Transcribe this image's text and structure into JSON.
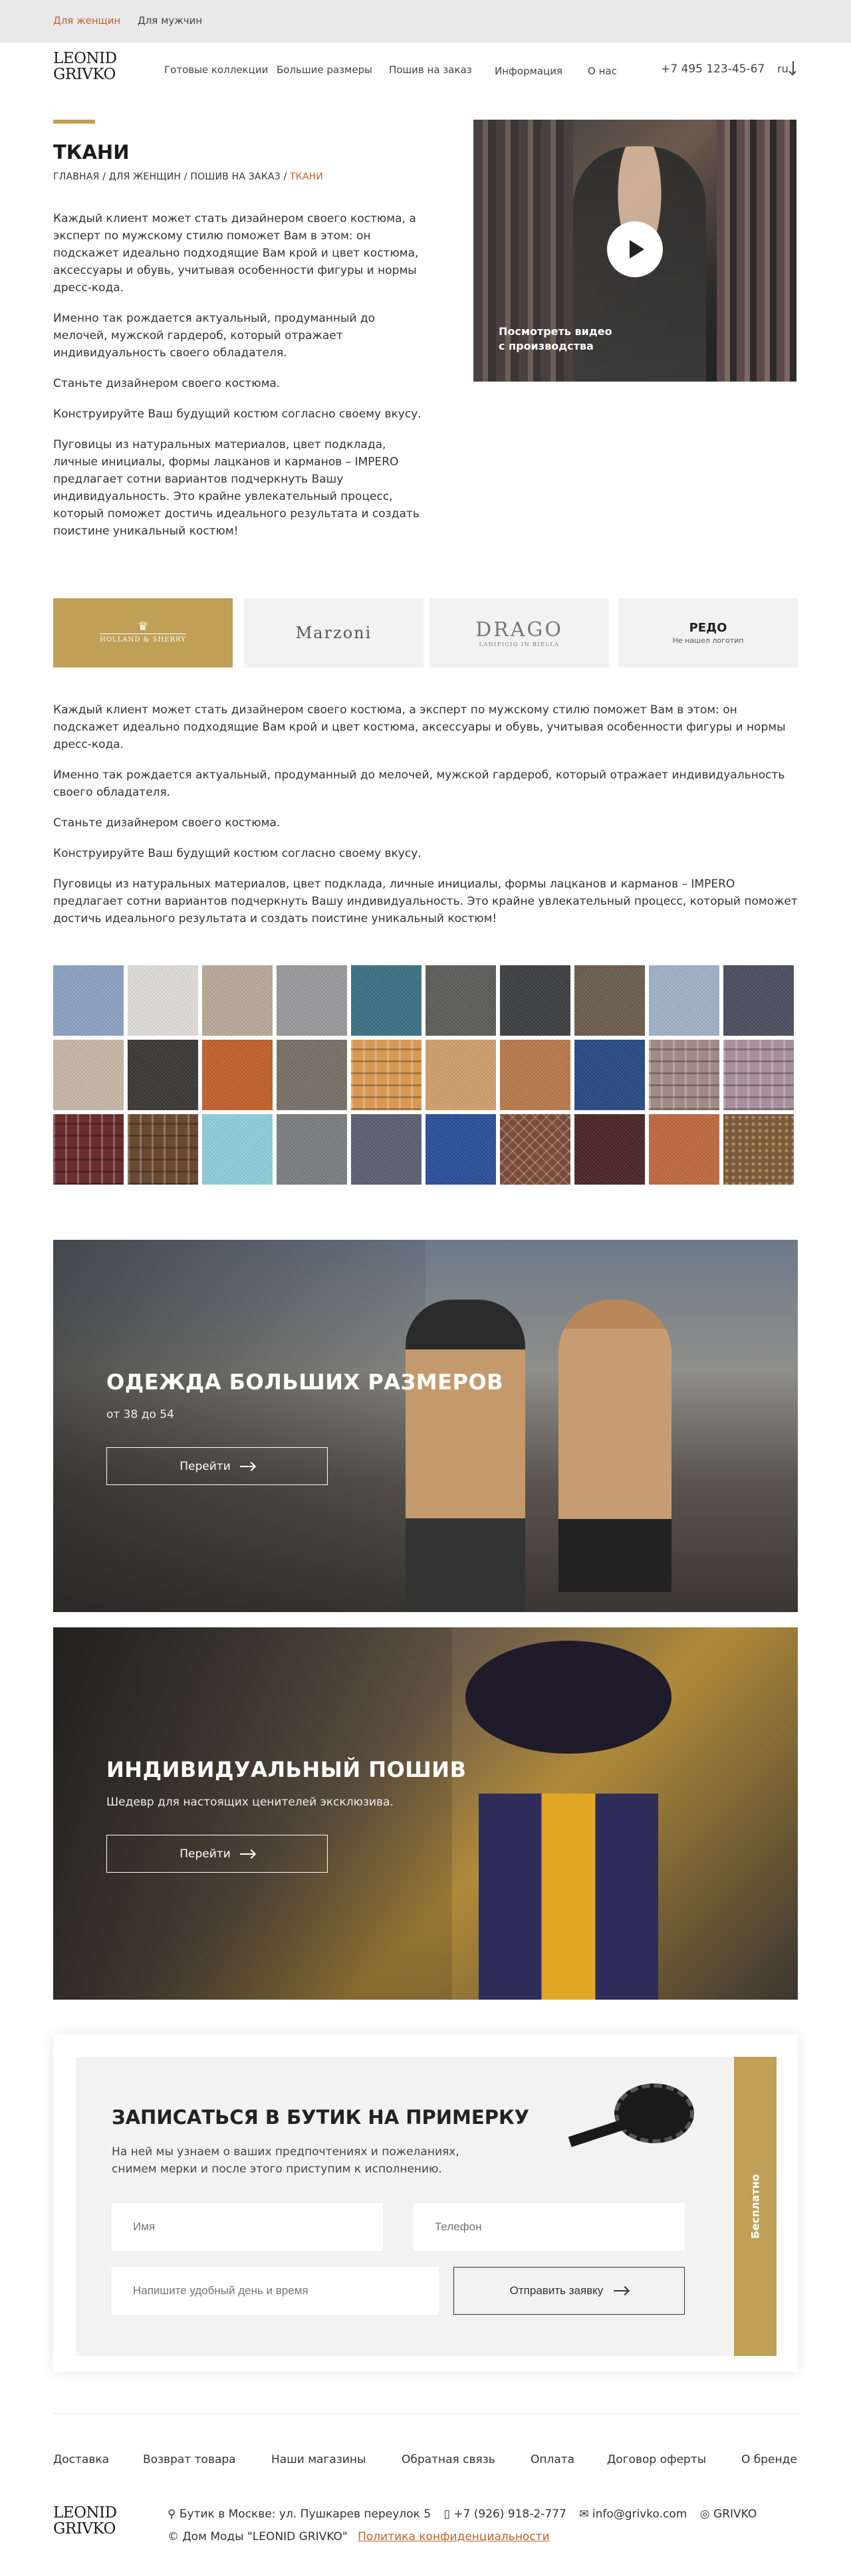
{
  "topbar": {
    "women": "Для женщин",
    "men": "Для мужчин",
    "accent": "#c0622a"
  },
  "header": {
    "logo_line1": "LEONID",
    "logo_line2": "GRIVKO",
    "nav": [
      "Готовые коллекции",
      "Большие размеры",
      "Пошив на заказ",
      "Информация",
      "О нас"
    ],
    "phone": "+7 495 123-45-67",
    "lang": "ru"
  },
  "page": {
    "title": "ТКАНИ",
    "breadcrumbs": [
      "ГЛАВНАЯ",
      "ДЛЯ ЖЕНЩИН",
      "ПОШИВ НА ЗАКАЗ",
      "ТКАНИ"
    ],
    "crumb_sep": " / ",
    "intro": [
      "Каждый клиент может стать дизайнером своего костюма, а эксперт по мужскому стилю поможет Вам в этом: он подскажет идеально подходящие Вам крой и цвет костюма, аксессуары и обувь, учитывая особенности фигуры и нормы дресс-кода.",
      "Именно так рождается актуальный, продуманный до мелочей, мужской гардероб, который отражает индивидуальность своего обладателя.",
      "Станьте дизайнером своего костюма.",
      "Конструируйте Ваш будущий костюм согласно своему вкусу.",
      "Пуговицы из натуральных материалов, цвет подклада, личные инициалы, формы лацканов и карманов – IMPERO предлагает сотни вариантов подчеркнуть Вашу индивидуальность. Это крайне увлекательный процесс, который поможет достичь идеального результата и создать поистине уникальный костюм!"
    ],
    "video_caption_1": "Посмотреть видео",
    "video_caption_2": "с производства"
  },
  "brands": {
    "holland_1": "HOLLAND & SHERRY",
    "marzoni": "Marzoni",
    "drago": "DRAGO",
    "drago_sub": "LANIFICIO IN BIELLA",
    "redo": "РЕДО",
    "redo_sub": "Не нашел логотип"
  },
  "body": [
    "Каждый клиент может стать дизайнером своего костюма, а эксперт по мужскому стилю поможет Вам в этом: он подскажет идеально подходящие Вам крой и цвет костюма, аксессуары и обувь, учитывая особенности фигуры и нормы дресс-кода.",
    "Именно так рождается актуальный, продуманный до мелочей, мужской гардероб, который отражает индивидуальность своего обладателя.",
    "Станьте дизайнером своего костюма.",
    "Конструируйте Ваш будущий костюм согласно своему вкусу.",
    "Пуговицы из натуральных материалов, цвет подклада, личные инициалы, формы лацканов и карманов – IMPERO предлагает сотни вариантов подчеркнуть Вашу индивидуальность. Это крайне увлекательный процесс, который поможет достичь идеального результата и создать поистине уникальный костюм!"
  ],
  "fabrics": [
    [
      "#8ea2c4",
      "#e0ddd8",
      "#b9aa97",
      "#9a9a9c",
      "#3c7184",
      "#5c5c5a",
      "#3d3f42",
      "#6a5e4c",
      "#9fb3c9",
      "#4a4e5e"
    ],
    [
      "#c8b7a6",
      "#3b3837",
      "#c2622c",
      "#7a7168",
      "#d79a55",
      "#d2a06f",
      "#b97a4a",
      "#284a86",
      "#a08a85",
      "#a7909c"
    ],
    [
      "#6b2d2d",
      "#6b4a33",
      "#8fd0dd",
      "#7d7e80",
      "#5c5f72",
      "#2a4f9c",
      "#7a4a3a",
      "#4b2626",
      "#bf6a3f",
      "#7a5a3e"
    ]
  ],
  "promo1": {
    "title": "ОДЕЖДА БОЛЬШИХ РАЗМЕРОВ",
    "subtitle": "от 38 до 54",
    "button": "Перейти"
  },
  "promo2": {
    "title": "ИНДИВИДУАЛЬНЫЙ ПОШИВ",
    "subtitle": "Шедевр для настоящих ценителей эксклюзива.",
    "button": "Перейти"
  },
  "form": {
    "title": "ЗАПИСАТЬСЯ В БУТИК НА ПРИМЕРКУ",
    "text_1": "На ней мы узнаем о ваших предпочтениях и пожеланиях,",
    "text_2": "снимем мерки и после этого приступим к исполнению.",
    "name_placeholder": "Имя",
    "phone_placeholder": "Телефон",
    "date_placeholder": "Напишите удобный день и время",
    "submit": "Отправить заявку",
    "free": "Бесплатно",
    "accent": "#bfa056"
  },
  "footer": {
    "links": [
      "Доставка",
      "Возврат товара",
      "Наши магазины",
      "Обратная связь",
      "Оплата",
      "Договор оферты",
      "О бренде"
    ],
    "address": "Бутик в Москве: ул. Пушкарев переулок 5",
    "phone": "+7 (926) 918-2-777",
    "email": "info@grivko.com",
    "social": "GRIVKO",
    "copyright": "© Дом Моды \"LEONID GRIVKO\"",
    "privacy": "Политика конфиденциальности"
  }
}
